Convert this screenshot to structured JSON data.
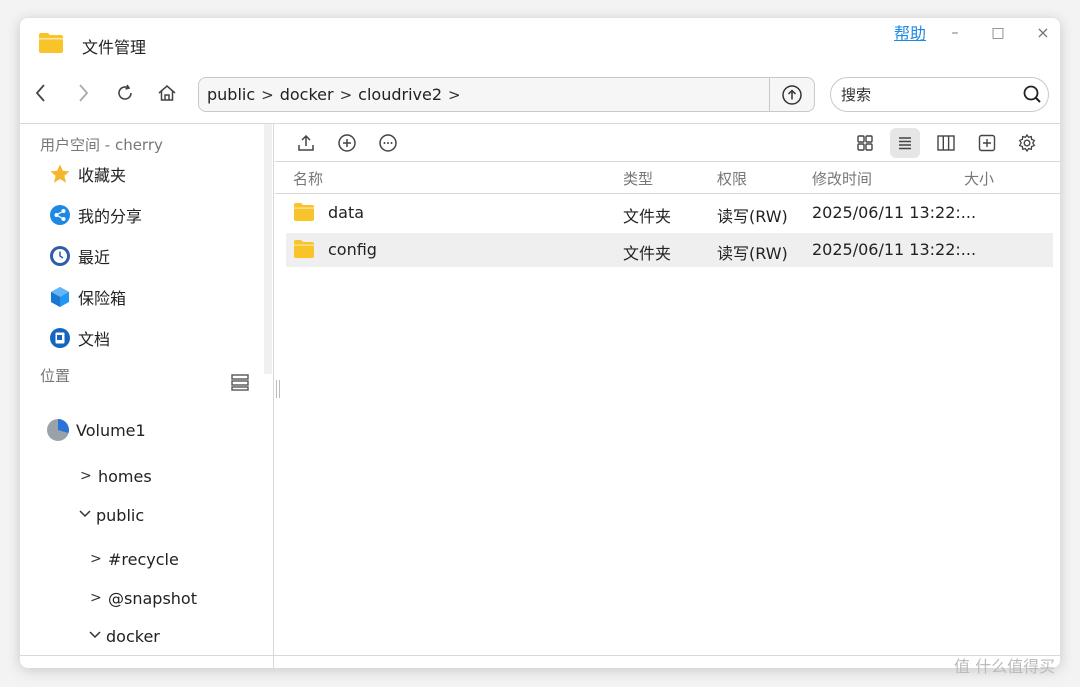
{
  "window": {
    "title": "文件管理",
    "help_label": "帮助",
    "minimize_glyph": "–",
    "maximize_glyph": "□",
    "close_glyph": "×"
  },
  "toolbar": {
    "breadcrumbs": [
      "public",
      "docker",
      "cloudrive2"
    ],
    "search_placeholder": "搜索"
  },
  "sidebar": {
    "user_space_label": "用户空间 - cherry",
    "items": [
      {
        "label": "收藏夹",
        "icon": "star-icon"
      },
      {
        "label": "我的分享",
        "icon": "share-icon"
      },
      {
        "label": "最近",
        "icon": "clock-icon"
      },
      {
        "label": "保险箱",
        "icon": "vault-icon"
      },
      {
        "label": "文档",
        "icon": "document-icon"
      }
    ],
    "location_label": "位置",
    "volume_label": "Volume1",
    "tree": [
      {
        "label": "homes",
        "expanded": false
      },
      {
        "label": "public",
        "expanded": true
      },
      {
        "label": "#recycle",
        "expanded": false
      },
      {
        "label": "@snapshot",
        "expanded": false
      },
      {
        "label": "docker",
        "expanded": true
      }
    ]
  },
  "table": {
    "columns": [
      "名称",
      "类型",
      "权限",
      "修改时间",
      "大小"
    ],
    "rows": [
      {
        "name": "data",
        "type": "文件夹",
        "perm": "读写(RW)",
        "modified": "2025/06/11 13:22:...",
        "size": ""
      },
      {
        "name": "config",
        "type": "文件夹",
        "perm": "读写(RW)",
        "modified": "2025/06/11 13:22:...",
        "size": ""
      }
    ]
  },
  "colors": {
    "accent": "#1e88e5",
    "folder": "#f8c42a",
    "selected_row": "#efefef"
  },
  "watermark": "值 什么值得买"
}
